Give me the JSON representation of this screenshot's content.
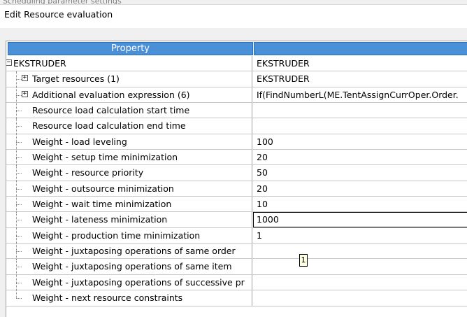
{
  "background_window": {
    "title_fragment": "Scheduling parameter settings"
  },
  "dialog": {
    "title": "Edit Resource evaluation"
  },
  "grid": {
    "header": {
      "property": "Property",
      "value": ""
    },
    "root": {
      "label": "EKSTRUDER",
      "value": "EKSTRUDER",
      "expander": "−"
    },
    "rows": [
      {
        "label": "Target resources (1)",
        "value": "EKSTRUDER",
        "expander": "+"
      },
      {
        "label": "Additional evaluation expression (6)",
        "value": "If(FindNumberL(ME.TentAssignCurrOper.Order.",
        "expander": "+"
      },
      {
        "label": "Resource load calculation start time",
        "value": ""
      },
      {
        "label": "Resource load calculation end time",
        "value": ""
      },
      {
        "label": "Weight - load leveling",
        "value": "100"
      },
      {
        "label": "Weight - setup time minimization",
        "value": "20"
      },
      {
        "label": "Weight - resource priority",
        "value": "50"
      },
      {
        "label": "Weight - outsource minimization",
        "value": "20"
      },
      {
        "label": "Weight - wait time minimization",
        "value": "10"
      },
      {
        "label": "Weight - lateness minimization",
        "value": "1000",
        "selected": true
      },
      {
        "label": "Weight - production time minimization",
        "value": "1"
      },
      {
        "label": "Weight - juxtaposing operations of same order",
        "value": ""
      },
      {
        "label": "Weight - juxtaposing operations of same item",
        "value": ""
      },
      {
        "label": "Weight - juxtaposing operations of successive pr",
        "value": ""
      },
      {
        "label": "Weight - next resource constraints",
        "value": ""
      }
    ]
  },
  "tooltip": {
    "text": "1"
  }
}
